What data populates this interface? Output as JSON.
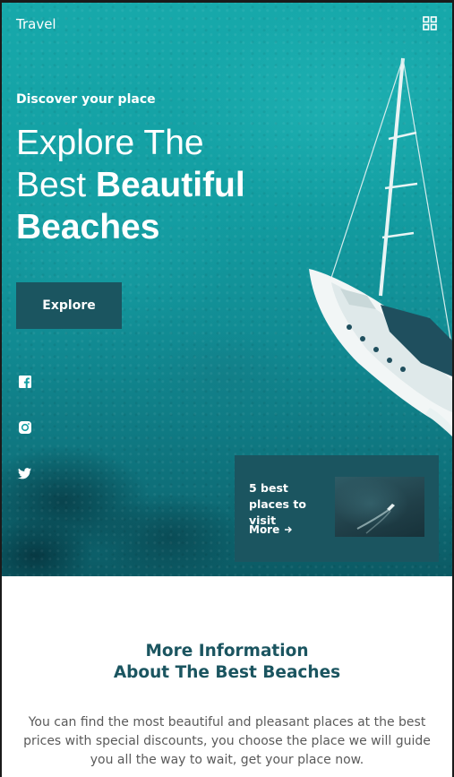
{
  "header": {
    "brand": "Travel",
    "menu_icon": "grid-icon"
  },
  "hero": {
    "subtitle": "Discover your place",
    "headline_line1": "Explore The",
    "headline_line2_regular": "Best ",
    "headline_line2_bold": "Beautiful",
    "headline_line3_bold": "Beaches",
    "explore_label": "Explore"
  },
  "social": [
    "facebook-icon",
    "instagram-icon",
    "twitter-icon"
  ],
  "card": {
    "title": "5 best places to visit",
    "more_label": "More",
    "more_icon": "arrow-right-icon"
  },
  "info": {
    "title_line1": "More Information",
    "title_line2": "About The Best Beaches",
    "text": "You can find the most beautiful and pleasant places at the best prices with special discounts, you choose the place we will guide you all the way to wait, get your place now."
  },
  "colors": {
    "accent": "#1b5560",
    "sea": "#139ea2",
    "text_muted": "#5a5a5a"
  }
}
